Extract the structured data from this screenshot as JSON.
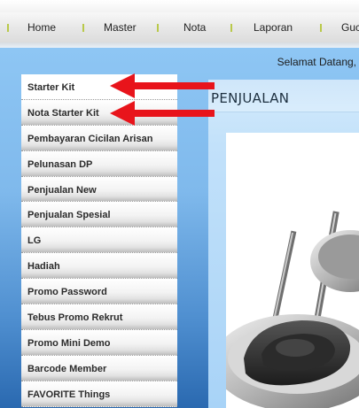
{
  "nav": {
    "items": [
      {
        "label": "Home"
      },
      {
        "label": "Master"
      },
      {
        "label": "Nota"
      },
      {
        "label": "Laporan"
      },
      {
        "label": "Guc"
      }
    ]
  },
  "header": {
    "welcome": "Selamat Datang,"
  },
  "sidebar": {
    "items": [
      {
        "label": "Starter Kit"
      },
      {
        "label": "Nota Starter Kit"
      },
      {
        "label": "Pembayaran Cicilan Arisan"
      },
      {
        "label": "Pelunasan DP"
      },
      {
        "label": "Penjualan New"
      },
      {
        "label": "Penjualan Spesial"
      },
      {
        "label": "LG"
      },
      {
        "label": "Hadiah"
      },
      {
        "label": "Promo Password"
      },
      {
        "label": "Tebus Promo Rekrut"
      },
      {
        "label": "Promo Mini Demo"
      },
      {
        "label": "Barcode Member"
      },
      {
        "label": "FAVORITE Things"
      }
    ]
  },
  "main": {
    "title": "PENJUALAN"
  },
  "colors": {
    "accent_arrow": "#e8141b",
    "nav_separator": "#b9c94a"
  }
}
